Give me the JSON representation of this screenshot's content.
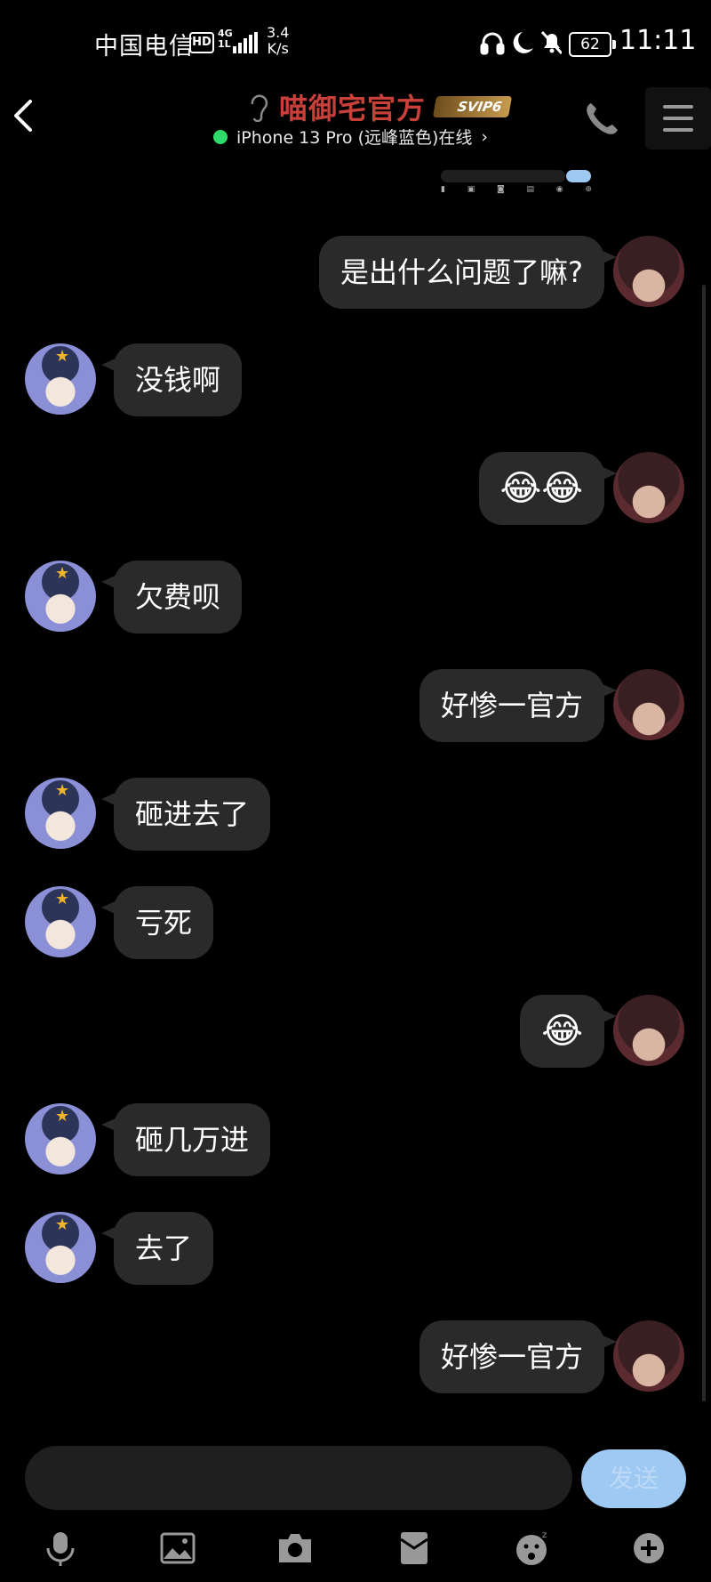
{
  "status_bar": {
    "carrier": "中国电信",
    "hd": "HD",
    "network_top": "4G",
    "network_bottom": "1L",
    "speed_value": "3.4",
    "speed_unit": "K/s",
    "battery": "62",
    "time": "11:11"
  },
  "header": {
    "title": "喵御宅官方",
    "badge": "SVIP6",
    "subtitle": "iPhone 13 Pro (远峰蓝色)在线"
  },
  "messages": [
    {
      "side": "out",
      "text": "是出什么问题了嘛?"
    },
    {
      "side": "in",
      "text": "没钱啊"
    },
    {
      "side": "out",
      "text": "😂😂"
    },
    {
      "side": "in",
      "text": "欠费呗"
    },
    {
      "side": "out",
      "text": "好惨一官方"
    },
    {
      "side": "in",
      "text": "砸进去了"
    },
    {
      "side": "in",
      "text": "亏死"
    },
    {
      "side": "out",
      "text": "😂"
    },
    {
      "side": "in",
      "text": "砸几万进"
    },
    {
      "side": "in",
      "text": "去了"
    },
    {
      "side": "out",
      "text": "好惨一官方"
    }
  ],
  "composer": {
    "send_label": "发送"
  },
  "toolbar_icons": [
    "microphone-icon",
    "image-icon",
    "camera-icon",
    "red-packet-icon",
    "sticker-icon",
    "plus-icon"
  ]
}
